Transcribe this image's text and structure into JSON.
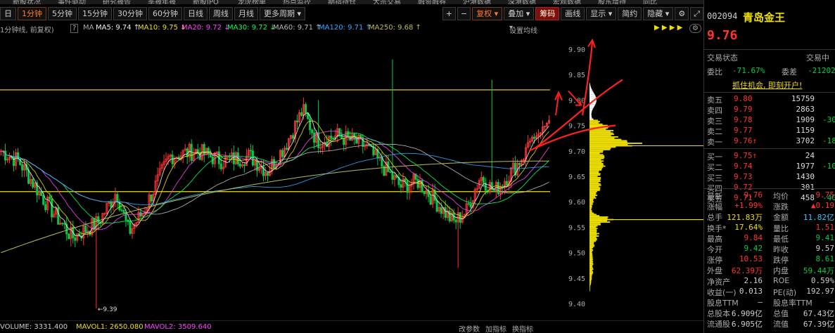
{
  "colors": {
    "up": "#ff3333",
    "down": "#00cc44",
    "yellow": "#f0e000",
    "cyan": "#33c8ff",
    "orange": "#ff7a2a",
    "ma5": "#f0f0f0",
    "ma10": "#f0e000",
    "ma20": "#ff44ff",
    "ma30": "#00ff66",
    "ma60": "#bbbbbb",
    "ma120": "#33aaff",
    "ma250": "#bbbb55"
  },
  "top_nav": [
    "新股状况",
    "事件驱动",
    "研究报告",
    "季报年报",
    "新股IPO",
    "龙虎榜单",
    "热点监控",
    "期指持仓",
    "大宗交易",
    "融资融券",
    "沪港数据",
    "深港数据",
    "宏观数据",
    "股东增持",
    "同比"
  ],
  "toolbar": {
    "period_buttons": [
      "日",
      "1分钟",
      "5分钟",
      "15分钟",
      "30分钟",
      "60分钟",
      "日线",
      "周线",
      "月线",
      "更多周期"
    ],
    "active_period": "1分钟",
    "plus": "+",
    "minus": "−",
    "fuquan": "复权",
    "diejia": "叠加",
    "chouma": "筹码",
    "huaxian": "画线",
    "xianshi": "显示",
    "jianyue": "简约",
    "yincang": "隐藏",
    "gear": "⚙",
    "fullscreen": "⤢"
  },
  "indicator_bar": {
    "prefix": "1分钟线, 前复权)",
    "help": "?",
    "ma_label": "MA",
    "ma5": "MA5: 9.74 ↑",
    "ma10": "MA10: 9.75 ↓",
    "ma20": "MA20: 9.72 ↓",
    "ma30": "MA30: 9.72 ↓",
    "ma60": "MA60: 9.71 ↑",
    "ma120": "MA120: 9.71 ↑",
    "ma250": "MA250: 9.68 ↑",
    "settings": "设置均线"
  },
  "chart_data": {
    "type": "candlestick",
    "y_axis": {
      "min": 9.4,
      "max": 9.9,
      "ticks": [
        "9.90",
        "9.85",
        "9.80",
        "9.75",
        "9.70",
        "9.65",
        "9.60",
        "9.55",
        "9.50",
        "9.45",
        "9.40"
      ]
    },
    "low_label": "←9.39",
    "horizontal_lines": [
      9.82,
      9.62
    ],
    "last_price": 9.76,
    "chips_peak_price": 9.71
  },
  "right_panel": {
    "code": "002094",
    "name": "青岛金王",
    "price": "9.76",
    "status_label": "交易状态",
    "status_value": "交易中",
    "weibi_label": "委比",
    "weibi_value": "-71.67%",
    "weicha_label": "委差",
    "weicha_value": "-21202",
    "promo": "抓住机会, 即刻开户!",
    "asks": [
      {
        "label": "卖五",
        "price": "9.80",
        "vol": "15759",
        "chg": ""
      },
      {
        "label": "卖四",
        "price": "9.79",
        "vol": "2863",
        "chg": ""
      },
      {
        "label": "卖三",
        "price": "9.78",
        "vol": "1909",
        "chg": "-30"
      },
      {
        "label": "卖二",
        "price": "9.77",
        "vol": "1159",
        "chg": ""
      },
      {
        "label": "卖一",
        "price": "9.76↑",
        "vol": "3702",
        "chg": "-18"
      }
    ],
    "bids": [
      {
        "label": "买一",
        "price": "9.75↑",
        "vol": "24",
        "chg": ""
      },
      {
        "label": "买二",
        "price": "9.74",
        "vol": "1977",
        "chg": "-102"
      },
      {
        "label": "买三",
        "price": "9.73",
        "vol": "1430",
        "chg": ""
      },
      {
        "label": "买四",
        "price": "9.72",
        "vol": "301",
        "chg": ""
      },
      {
        "label": "买五",
        "price": "9.71",
        "vol": "458",
        "chg": "-40"
      }
    ],
    "stats": [
      {
        "l1": "最新",
        "v1": "9.76",
        "c1": "up",
        "l2": "均价",
        "v2": "9.75",
        "c2": "up"
      },
      {
        "l1": "涨幅",
        "v1": "+1.99%",
        "c1": "up",
        "l2": "涨跌",
        "v2": "▲0.19",
        "c2": "up"
      },
      {
        "l1": "总手",
        "v1": "121.83万",
        "c1": "yellow",
        "l2": "金额",
        "v2": "11.82亿",
        "c2": "cyan"
      },
      {
        "l1": "换手*",
        "v1": "17.64%",
        "c1": "yellow",
        "l2": "量比",
        "v2": "1.51",
        "c2": "up"
      },
      {
        "l1": "最高",
        "v1": "9.84",
        "c1": "up",
        "l2": "最低",
        "v2": "9.41",
        "c2": "down"
      },
      {
        "l1": "今开",
        "v1": "9.42",
        "c1": "down",
        "l2": "昨收",
        "v2": "9.57",
        "c2": "white"
      },
      {
        "l1": "涨停",
        "v1": "10.53",
        "c1": "up",
        "l2": "跌停",
        "v2": "8.61",
        "c2": "down"
      },
      {
        "l1": "外盘",
        "v1": "62.39万",
        "c1": "up",
        "l2": "内盘",
        "v2": "59.44万",
        "c2": "down"
      },
      {
        "l1": "净资产",
        "v1": "2.16",
        "c1": "white",
        "l2": "ROE",
        "v2": "0.59%",
        "c2": "white"
      },
      {
        "l1": "收益(一)",
        "v1": "0.013",
        "c1": "white",
        "l2": "PE(动)",
        "v2": "192.97",
        "c2": "white"
      },
      {
        "l1": "股息TTM",
        "v1": "—",
        "c1": "white",
        "l2": "股息率TTM",
        "v2": "—",
        "c2": "white"
      },
      {
        "l1": "总股本",
        "v1": "6.909亿",
        "c1": "white",
        "l2": "总值",
        "v2": "67.43亿",
        "c2": "white"
      },
      {
        "l1": "流通股",
        "v1": "6.905亿",
        "c1": "white",
        "l2": "流值",
        "v2": "67.39亿",
        "c2": "white"
      }
    ]
  },
  "bottom_bar": {
    "volume": "VOLUME: 3331.400",
    "mavol1": "MAVOL1: 2650.080",
    "mavol2": "MAVOL2: 3509.640",
    "params": "改参数",
    "add_indicator": "加指标",
    "switch_indicator": "换指标"
  }
}
